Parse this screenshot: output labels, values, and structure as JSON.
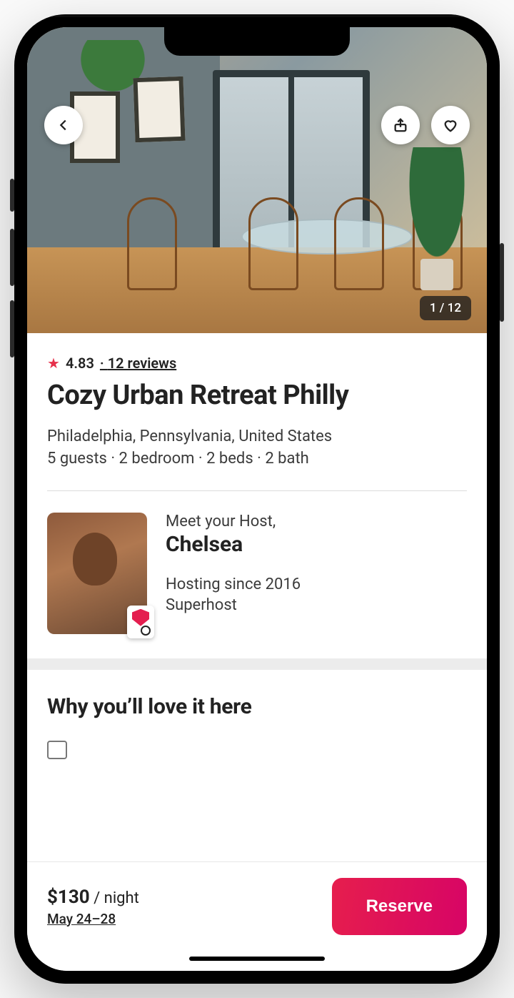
{
  "photo_counter": "1 / 12",
  "rating": "4.83",
  "reviews_text": "12 reviews",
  "title": "Cozy Urban Retreat Philly",
  "location": "Philadelphia, Pennsylvania, United States",
  "specs": "5 guests · 2 bedroom · 2 beds · 2 bath",
  "host": {
    "meet_label": "Meet your Host,",
    "name": "Chelsea",
    "since": "Hosting since 2016",
    "role": "Superhost"
  },
  "love_heading": "Why you’ll love it here",
  "bottom": {
    "price": "$130",
    "unit": " / night",
    "dates": "May 24–28",
    "reserve_label": "Reserve"
  }
}
